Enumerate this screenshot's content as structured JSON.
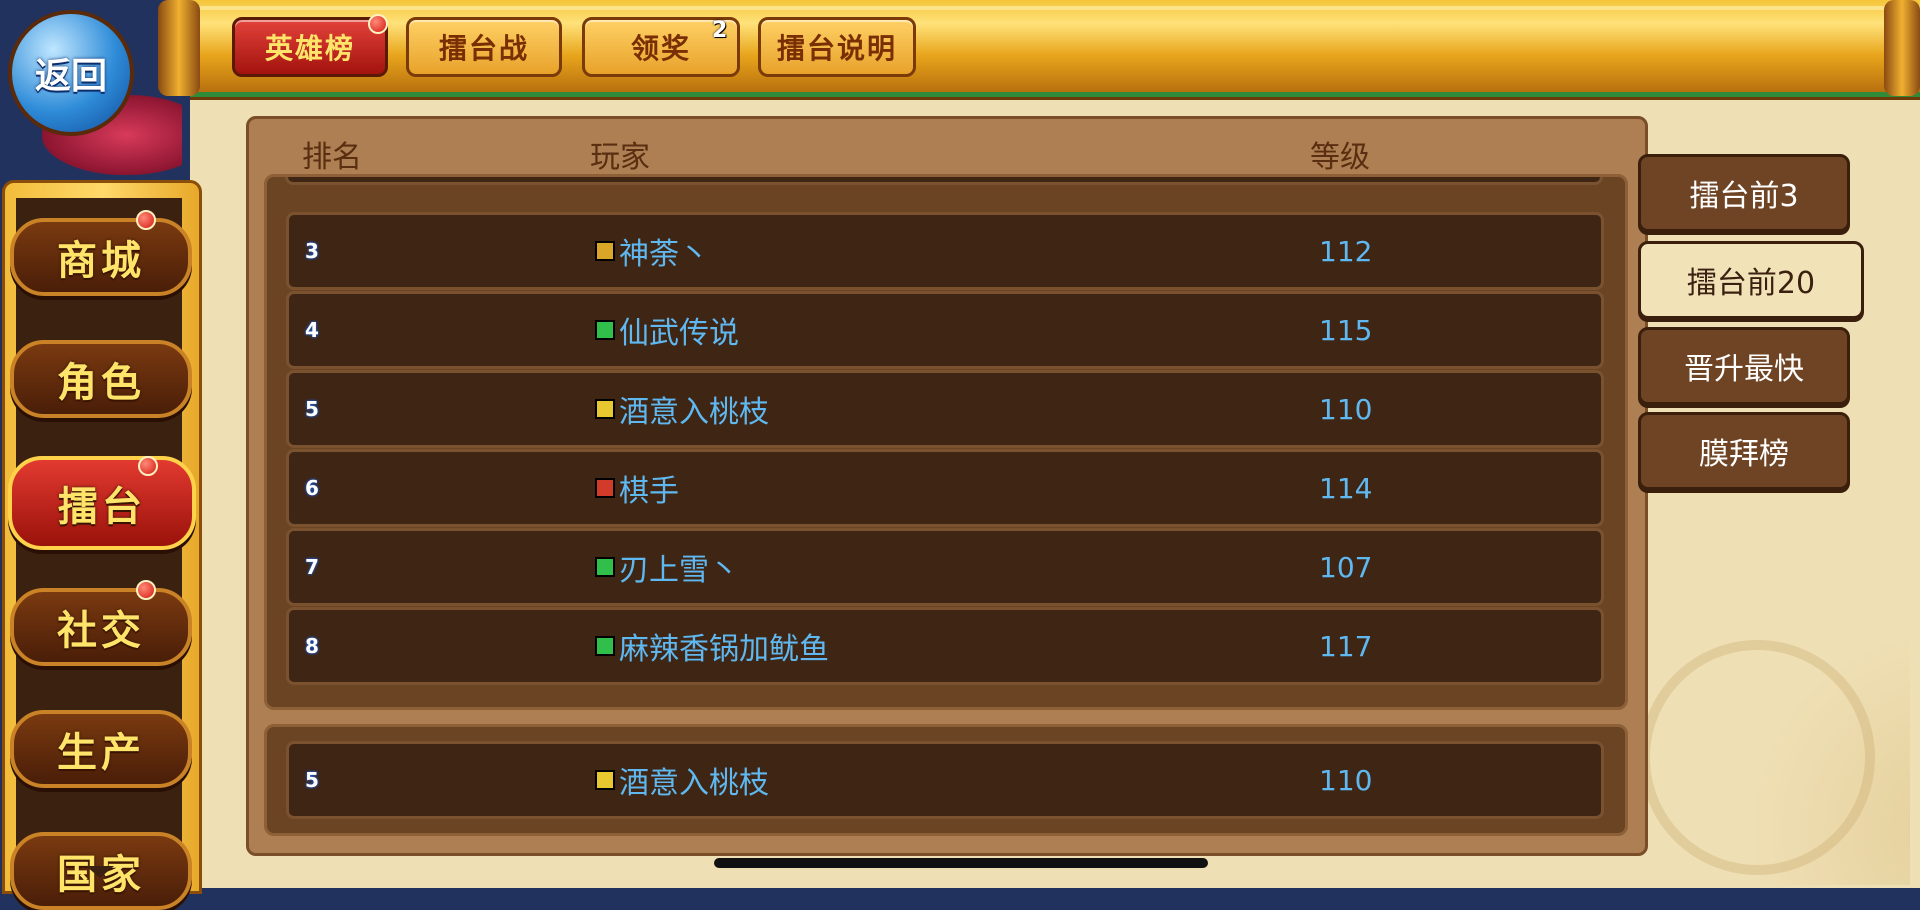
{
  "top_tabs": [
    {
      "label": "英雄榜",
      "active": true,
      "dot": true
    },
    {
      "label": "擂台战",
      "active": false
    },
    {
      "label": "领奖",
      "active": false,
      "badge": "2"
    },
    {
      "label": "擂台说明",
      "active": false
    }
  ],
  "return_label": "返回",
  "sidebar": [
    {
      "label": "商城",
      "dot": true
    },
    {
      "label": "角色"
    },
    {
      "label": "擂台",
      "active": true,
      "dot": true
    },
    {
      "label": "社交",
      "dot": true
    },
    {
      "label": "生产"
    },
    {
      "label": "国家"
    }
  ],
  "table": {
    "headers": {
      "rank": "排名",
      "player": "玩家",
      "level": "等级"
    },
    "rows": [
      {
        "rank": "3",
        "name": "神荼丶",
        "level": "112",
        "sect_color": "#d9a628"
      },
      {
        "rank": "4",
        "name": "仙武传说",
        "level": "115",
        "sect_color": "#2fbf4a"
      },
      {
        "rank": "5",
        "name": "酒意入桃枝",
        "level": "110",
        "sect_color": "#e8c830"
      },
      {
        "rank": "6",
        "name": "棋手",
        "level": "114",
        "sect_color": "#d23a2a"
      },
      {
        "rank": "7",
        "name": "刃上雪丶",
        "level": "107",
        "sect_color": "#2fbf4a"
      },
      {
        "rank": "8",
        "name": "麻辣香锅加鱿鱼",
        "level": "117",
        "sect_color": "#2fbf4a"
      }
    ],
    "self_row": {
      "rank": "5",
      "name": "酒意入桃枝",
      "level": "110",
      "sect_color": "#e8c830"
    }
  },
  "right_tabs": [
    {
      "label": "擂台前3",
      "active": false
    },
    {
      "label": "擂台前20",
      "active": true
    },
    {
      "label": "晋升最快",
      "active": false
    },
    {
      "label": "膜拜榜",
      "active": false
    }
  ]
}
